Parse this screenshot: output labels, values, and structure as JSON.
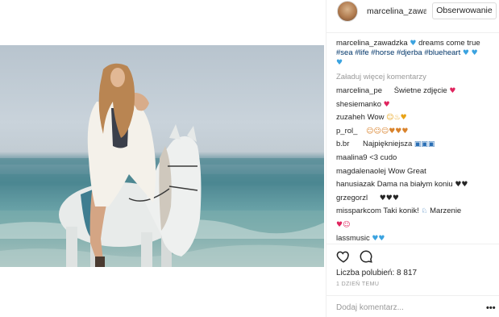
{
  "post": {
    "username": "marcelina_zawadzka",
    "header_username": "marcelina_zawac",
    "follow_label": "Obserwowanie",
    "caption_text": "dreams come true",
    "hashtags": "#sea #life #horse #djerba #blueheart",
    "load_more": "Załaduj więcej komentarzy",
    "likes": "Liczba polubień: 8 817",
    "time": "1 DZIEŃ TEMU",
    "add_comment_placeholder": "Dodaj komentarz...",
    "more_options": "•••"
  },
  "comments": [
    {
      "user": "marcelina_pe",
      "text": "Świetne zdjęcie",
      "emoji": "♥"
    },
    {
      "user": "shesiemanko",
      "text": "",
      "emoji": "♥"
    },
    {
      "user": "zuzaheh",
      "text": "Wow",
      "emoji": "☺♨♥"
    },
    {
      "user": "p_rol_",
      "text": "",
      "emoji": "☺☺☺♥♥♥"
    },
    {
      "user": "b.br",
      "text": "Najpiękniejsza",
      "emoji": "▣▣▣"
    },
    {
      "user": "maalina9",
      "text": "<3 cudo",
      "emoji": ""
    },
    {
      "user": "magdalenaolej",
      "text": "Wow Great",
      "emoji": ""
    },
    {
      "user": "hanusiazak",
      "text": "Dama na białym koniu",
      "emoji": "♥♥"
    },
    {
      "user": "grzegorzl",
      "text": "",
      "emoji": "♥♥♥"
    },
    {
      "user": "missparkcom",
      "text": "Taki konik!",
      "emoji": "♘"
    },
    {
      "user": "lassmusic",
      "text": "",
      "emoji": "♥♥"
    }
  ],
  "extra": {
    "missparkcom_text2": "Marzenie",
    "missparkcom_emoji2": "♥☺"
  },
  "colors": {
    "blue_heart": "#3ba3e0",
    "hashtag": "#003569",
    "muted": "#999999"
  },
  "icons": [
    "heart-icon",
    "comment-icon",
    "more-options-icon"
  ]
}
